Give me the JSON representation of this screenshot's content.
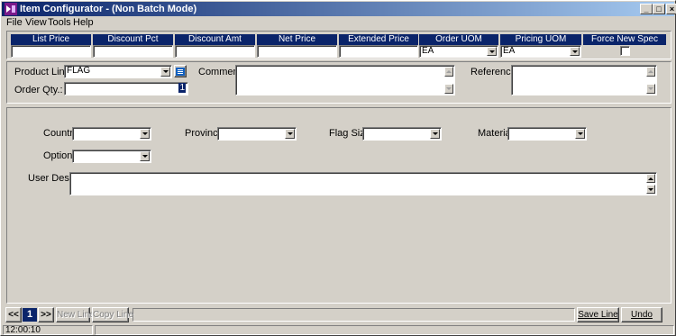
{
  "window": {
    "title": "Item Configurator - (Non Batch Mode)"
  },
  "menu": [
    "File",
    "View",
    "Tools",
    "Help"
  ],
  "columns": [
    {
      "header": "List Price",
      "value": ""
    },
    {
      "header": "Discount Pct",
      "value": ""
    },
    {
      "header": "Discount Amt",
      "value": ""
    },
    {
      "header": "Net Price",
      "value": ""
    },
    {
      "header": "Extended Price",
      "value": ""
    },
    {
      "header": "Order UOM",
      "value": "EA"
    },
    {
      "header": "Pricing UOM",
      "value": "EA"
    },
    {
      "header": "Force New Spec",
      "value": ""
    }
  ],
  "line": {
    "product_line_label": "Product Line:",
    "product_line_value": "FLAG",
    "order_qty_label": "Order Qty.:",
    "order_qty_value": "1",
    "comment_label": "Comment:",
    "reference_label": "Reference:"
  },
  "spec": {
    "country_label": "Country",
    "province_label": "Province",
    "flag_size_label": "Flag Size",
    "material_label": "Material",
    "options_label": "Options",
    "user_descrip_label": "User Descrip"
  },
  "nav": {
    "prev": "<<",
    "page": "1",
    "next": ">>",
    "new_line": "New Line",
    "copy_line": "Copy Line",
    "save_line": "Save Line",
    "undo": "Undo"
  },
  "status": {
    "time": "12:00:10"
  },
  "colors": {
    "header_bg": "#0a246a",
    "title_start": "#0a246a",
    "title_end": "#a6caf0",
    "face": "#d4d0c8"
  }
}
